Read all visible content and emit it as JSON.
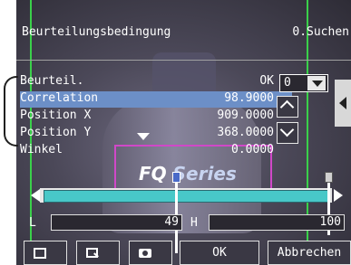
{
  "header": {
    "title": "Beurteilungsbedingung",
    "right_label": "0.Suchen"
  },
  "rows": [
    {
      "label": "Beurteil.",
      "value": "OK"
    },
    {
      "label": "Correlation",
      "value": "98.9000"
    },
    {
      "label": "Position X",
      "value": "909.0000"
    },
    {
      "label": "Position Y",
      "value": "368.0000"
    },
    {
      "label": "Winkel",
      "value": "0.0000"
    }
  ],
  "selected_row_index": 1,
  "dropdown": {
    "value": "0"
  },
  "background": {
    "product_text_a": "FQ ",
    "product_text_b": "Series"
  },
  "slider": {
    "low_label": "L",
    "low_value": "49",
    "high_label": "H",
    "high_value": "100",
    "low_fraction": 0.49,
    "high_fraction": 1.0
  },
  "buttons": {
    "ok": "OK",
    "cancel": "Abbrechen"
  },
  "icons": [
    "frame-icon",
    "zoom-icon",
    "camera-icon"
  ],
  "colors": {
    "selected_row": "#6c8fc7",
    "slider_fill": "#48c8c8",
    "roi_border": "#d048c8"
  }
}
